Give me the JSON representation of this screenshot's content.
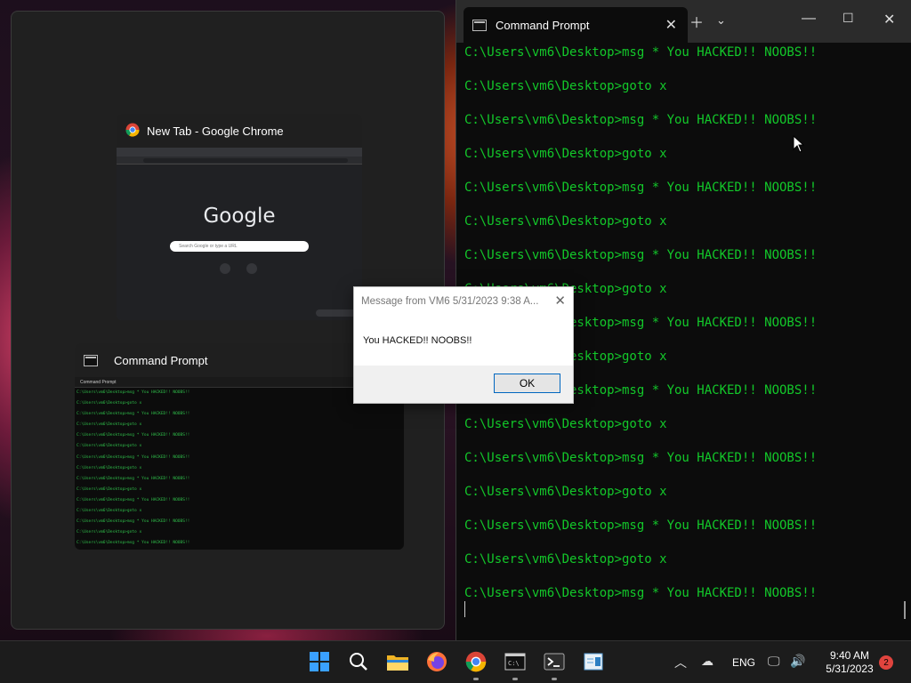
{
  "snap_assist": {
    "chrome_thumb_title": "New Tab - Google Chrome",
    "chrome_google_logo": "Google",
    "chrome_search_placeholder": "Search Google or type a URL",
    "cmd_thumb_title": "Command Prompt",
    "cmd_thumb_tab": "Command Prompt"
  },
  "terminal": {
    "tab_title": "Command Prompt",
    "lines": [
      "C:\\Users\\vm6\\Desktop>msg * You HACKED!! NOOBS!!",
      "C:\\Users\\vm6\\Desktop>goto x",
      "C:\\Users\\vm6\\Desktop>msg * You HACKED!! NOOBS!!",
      "C:\\Users\\vm6\\Desktop>goto x",
      "C:\\Users\\vm6\\Desktop>msg * You HACKED!! NOOBS!!",
      "C:\\Users\\vm6\\Desktop>goto x",
      "C:\\Users\\vm6\\Desktop>msg * You HACKED!! NOOBS!!",
      "C:\\Users\\vm6\\Desktop>goto x",
      "C:\\Users\\vm6\\Desktop>msg * You HACKED!! NOOBS!!",
      "C:\\Users\\vm6\\Desktop>goto x",
      "C:\\Users\\vm6\\Desktop>msg * You HACKED!! NOOBS!!",
      "C:\\Users\\vm6\\Desktop>goto x",
      "C:\\Users\\vm6\\Desktop>msg * You HACKED!! NOOBS!!",
      "C:\\Users\\vm6\\Desktop>goto x",
      "C:\\Users\\vm6\\Desktop>msg * You HACKED!! NOOBS!!",
      "C:\\Users\\vm6\\Desktop>goto x",
      "C:\\Users\\vm6\\Desktop>msg * You HACKED!! NOOBS!!"
    ]
  },
  "dialog": {
    "title": "Message from VM6 5/31/2023 9:38 A...",
    "message": "You HACKED!! NOOBS!!",
    "ok_label": "OK"
  },
  "taskbar": {
    "language": "ENG",
    "time": "9:40 AM",
    "date": "5/31/2023",
    "notification_count": "2",
    "apps": [
      "start-icon",
      "search-icon",
      "file-explorer-icon",
      "firefox-icon",
      "chrome-icon",
      "command-prompt-icon",
      "terminal-icon",
      "notepad-icon"
    ]
  },
  "colors": {
    "terminal_text": "#13c82a",
    "windows_accent": "#3aa0ff",
    "badge": "#e0443e"
  }
}
